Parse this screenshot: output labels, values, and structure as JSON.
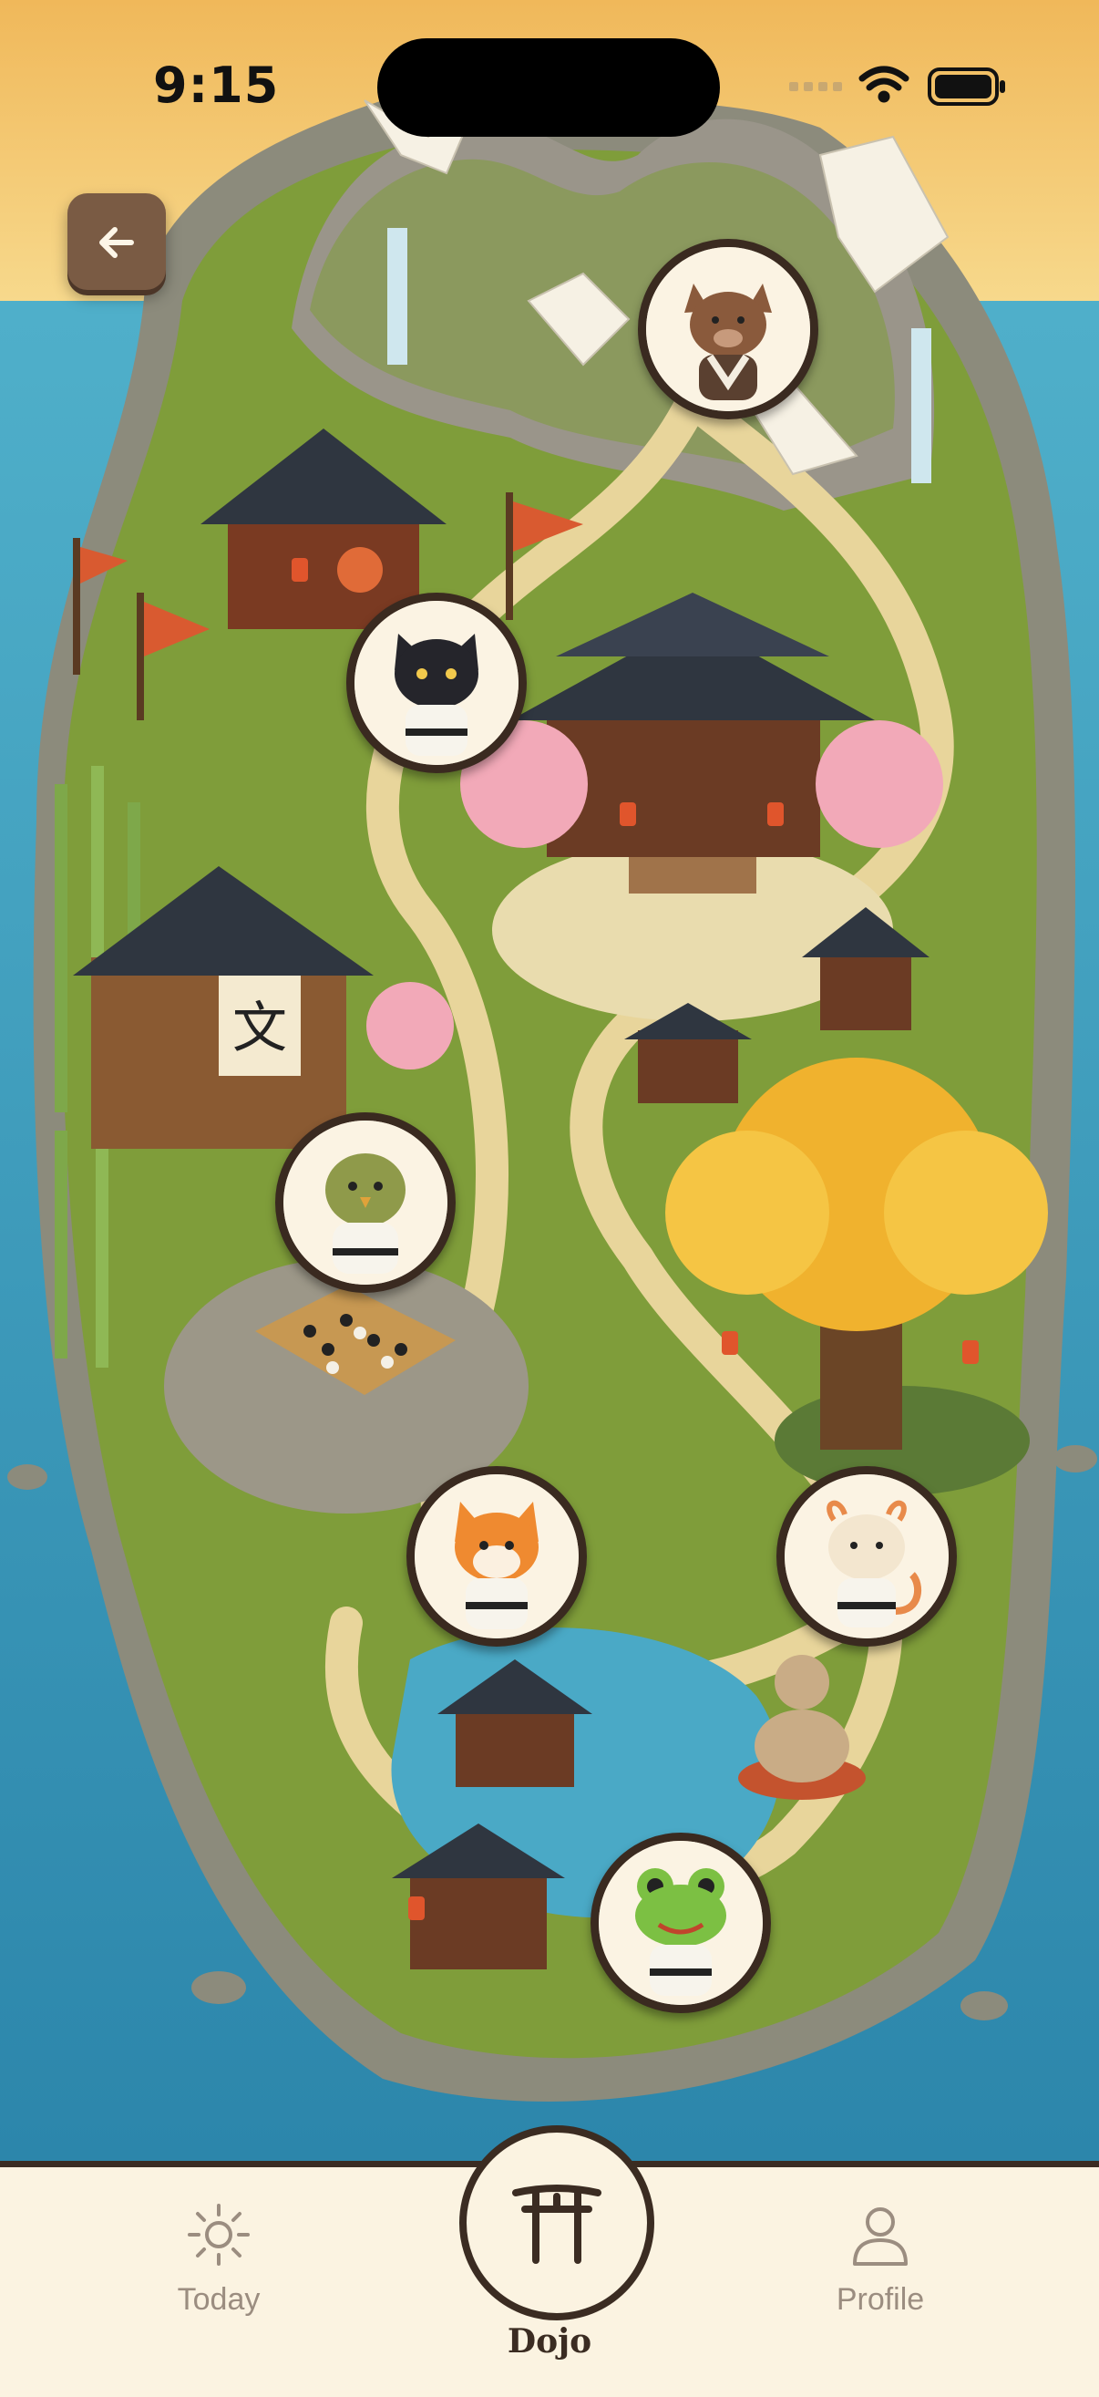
{
  "status_bar": {
    "time": "9:15",
    "icons": [
      "signal-dots-icon",
      "wifi-icon",
      "battery-icon"
    ]
  },
  "header": {
    "back_icon": "arrow-left-icon"
  },
  "map": {
    "nodes": [
      {
        "id": "boar",
        "character": "boar"
      },
      {
        "id": "cat",
        "character": "black-cat"
      },
      {
        "id": "bird",
        "character": "bird"
      },
      {
        "id": "fox",
        "character": "fox"
      },
      {
        "id": "dragon",
        "character": "dragon"
      },
      {
        "id": "frog",
        "character": "frog"
      }
    ],
    "dojo_sign": "文"
  },
  "tab_bar": {
    "tabs": [
      {
        "id": "today",
        "label": "Today",
        "icon": "sun-icon",
        "active": false
      },
      {
        "id": "dojo",
        "label": "Dojo",
        "icon": "torii-gate-icon",
        "active": true
      },
      {
        "id": "profile",
        "label": "Profile",
        "icon": "person-icon",
        "active": false
      }
    ]
  },
  "colors": {
    "sky": "#f2c063",
    "ocean": "#2e8fb0",
    "grass": "#7f9d3a",
    "path": "#e8d59b",
    "frame": "#3a2a20",
    "tab_bg": "#fbf3e1",
    "back_button": "#7a5b44",
    "tree_gold": "#f0b22e"
  }
}
